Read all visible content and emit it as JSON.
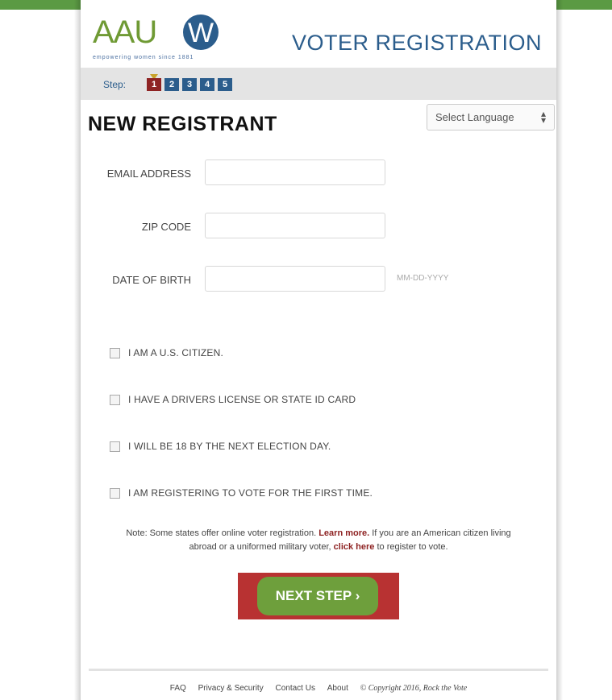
{
  "header": {
    "logo_text": "AAU",
    "logo_w": "W",
    "logo_tagline": "empowering women since 1881",
    "title": "VOTER REGISTRATION"
  },
  "steps": {
    "label": "Step:",
    "items": [
      "1",
      "2",
      "3",
      "4",
      "5"
    ],
    "active": "1"
  },
  "heading": "NEW REGISTRANT",
  "language_select": {
    "value": "Select Language"
  },
  "form": {
    "email_label": "EMAIL ADDRESS",
    "zip_label": "ZIP CODE",
    "dob_label": "DATE OF BIRTH",
    "dob_hint": "MM-DD-YYYY"
  },
  "checkboxes": [
    "I AM A U.S. CITIZEN.",
    "I HAVE A DRIVERS LICENSE OR STATE ID CARD",
    "I WILL BE 18 BY THE NEXT ELECTION DAY.",
    "I AM REGISTERING TO VOTE FOR THE FIRST TIME."
  ],
  "note": {
    "part1": "Note: Some states offer online voter registration.",
    "learn_more": "Learn more.",
    "part2": "If you are an American citizen living",
    "part3": "abroad or a uniformed military voter,",
    "click_here": "click here",
    "part4": "to register to vote."
  },
  "next_button": "NEXT STEP ›",
  "footer": {
    "faq": "FAQ",
    "privacy": "Privacy & Security",
    "contact": "Contact Us",
    "about": "About",
    "copyright": "© Copyright 2016, Rock the Vote"
  },
  "colors": {
    "brand_blue": "#2b5d8c",
    "brand_green": "#6e9f3c",
    "brand_red": "#b83232",
    "step_active": "#8e2323"
  }
}
